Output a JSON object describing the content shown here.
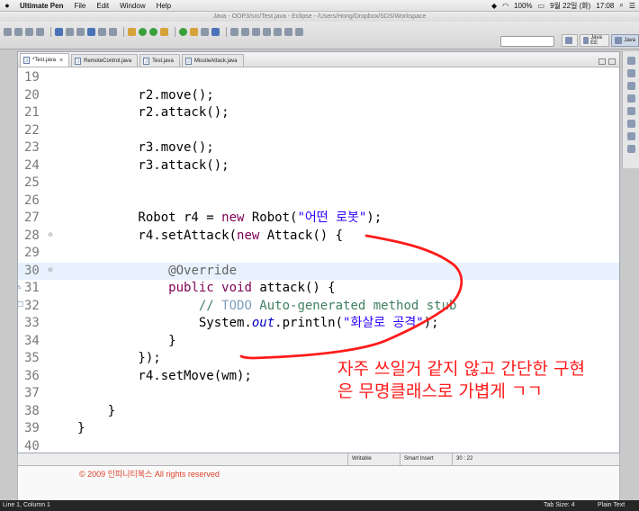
{
  "menubar": {
    "app_name": "Ultimate Pen",
    "items": [
      "File",
      "Edit",
      "Window",
      "Help"
    ],
    "battery": "100%",
    "datetime": "9월 22일 (화)",
    "clock": "17:08"
  },
  "window": {
    "title": "Java - OOP3/src/Test.java - Eclipse - /Users/Hong/Dropbox/SDS/Workspace"
  },
  "perspectives": {
    "java_ee": "Java EE",
    "java": "Java"
  },
  "tabs": [
    {
      "label": "*Test.java",
      "active": true
    },
    {
      "label": "RemoteControl.java",
      "active": false
    },
    {
      "label": "Test.java",
      "active": false
    },
    {
      "label": "MissileAttack.java",
      "active": false
    }
  ],
  "editor": {
    "lines": [
      {
        "n": "19",
        "text": ""
      },
      {
        "n": "20",
        "text": "        r2.move();"
      },
      {
        "n": "21",
        "text": "        r2.attack();"
      },
      {
        "n": "22",
        "text": ""
      },
      {
        "n": "23",
        "text": "        r3.move();"
      },
      {
        "n": "24",
        "text": "        r3.attack();"
      },
      {
        "n": "25",
        "text": ""
      },
      {
        "n": "26",
        "text": ""
      },
      {
        "n": "27",
        "text": "        Robot r4 = new Robot(\"어떤 로봇\");"
      },
      {
        "n": "28",
        "text": "        r4.setAttack(new Attack() {"
      },
      {
        "n": "29",
        "text": ""
      },
      {
        "n": "30",
        "text": "            @Override"
      },
      {
        "n": "31",
        "text": "            public void attack() {"
      },
      {
        "n": "32",
        "text": "                // TODO Auto-generated method stub"
      },
      {
        "n": "33",
        "text": "                System.out.println(\"화살로 공격\");"
      },
      {
        "n": "34",
        "text": "            }"
      },
      {
        "n": "35",
        "text": "        });"
      },
      {
        "n": "36",
        "text": "        r4.setMove(wm);"
      },
      {
        "n": "37",
        "text": ""
      },
      {
        "n": "38",
        "text": "    }"
      },
      {
        "n": "39",
        "text": "}"
      },
      {
        "n": "40",
        "text": ""
      }
    ],
    "highlighted_line": "30"
  },
  "status": {
    "writable": "Writable",
    "insert_mode": "Smart Insert",
    "position": "30 : 22"
  },
  "copyright": "© 2009 인피니티북스 All rights reserved",
  "bottom_status": {
    "cursor": "Line 1, Column 1",
    "tab_size": "Tab Size: 4",
    "mode": "Plain Text"
  },
  "annotation": {
    "line1": "자주 쓰일거 같지 않고 간단한 구현",
    "line2": "은 무명클래스로 가볍게 ㄱㄱ",
    "color": "#ff1a1a"
  }
}
